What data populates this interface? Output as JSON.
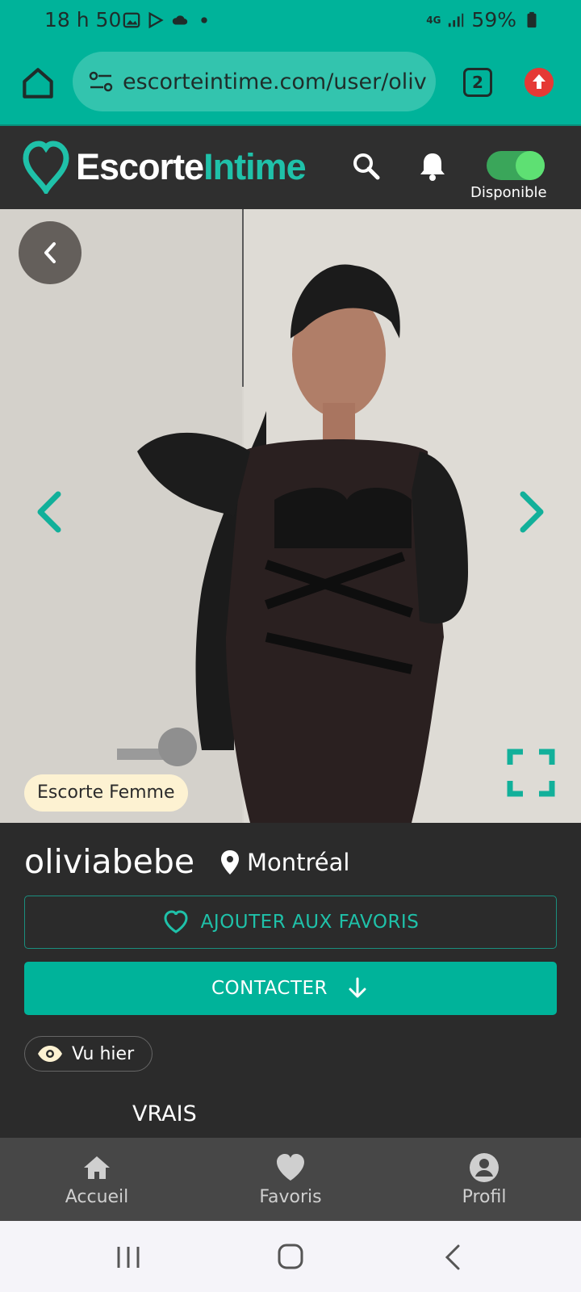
{
  "status_bar": {
    "time": "18 h 50",
    "network": "4G",
    "battery": "59%"
  },
  "browser": {
    "url": "escorteintime.com/user/oliv",
    "tab_count": "2"
  },
  "header": {
    "logo_part1": "Escorte",
    "logo_part2": "Intime",
    "availability_label": "Disponible",
    "availability_on": true
  },
  "gallery": {
    "category": "Escorte Femme"
  },
  "profile": {
    "username": "oliviabebe",
    "location": "Montréal",
    "favorite_button": "AJOUTER AUX FAVORIS",
    "contact_button": "CONTACTER",
    "last_seen": "Vu hier",
    "section_heading": "VRAIS"
  },
  "bottom_nav": {
    "items": [
      {
        "label": "Accueil",
        "icon": "home-icon"
      },
      {
        "label": "Favoris",
        "icon": "heart-icon"
      },
      {
        "label": "Profil",
        "icon": "user-icon"
      }
    ]
  },
  "colors": {
    "accent": "#00b39a",
    "dark_bg": "#2b2b2b",
    "header_bg": "#2f2f2f",
    "nav_bg": "#474747"
  }
}
